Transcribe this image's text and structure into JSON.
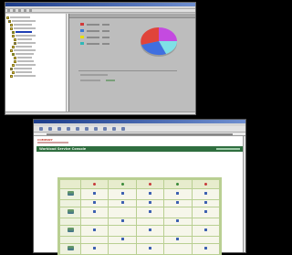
{
  "top_window": {
    "tree_items": [
      "",
      "",
      "",
      "",
      "",
      "",
      "",
      "",
      "",
      "",
      "",
      "",
      "",
      "",
      "",
      "",
      ""
    ],
    "legend_colors": [
      "#d23a3a",
      "#3a7bd5",
      "#e8e000",
      "#2fb8b8"
    ],
    "pie_colors": {
      "red": "#e0443a",
      "blue": "#3f6fe0",
      "cyan": "#7fe0e6",
      "magenta": "#c44ae0"
    }
  },
  "bottom_window": {
    "logo": "COMPANY",
    "banner_title": "Workload Service Console",
    "grid_rows": 8,
    "grid_cols": 5
  }
}
